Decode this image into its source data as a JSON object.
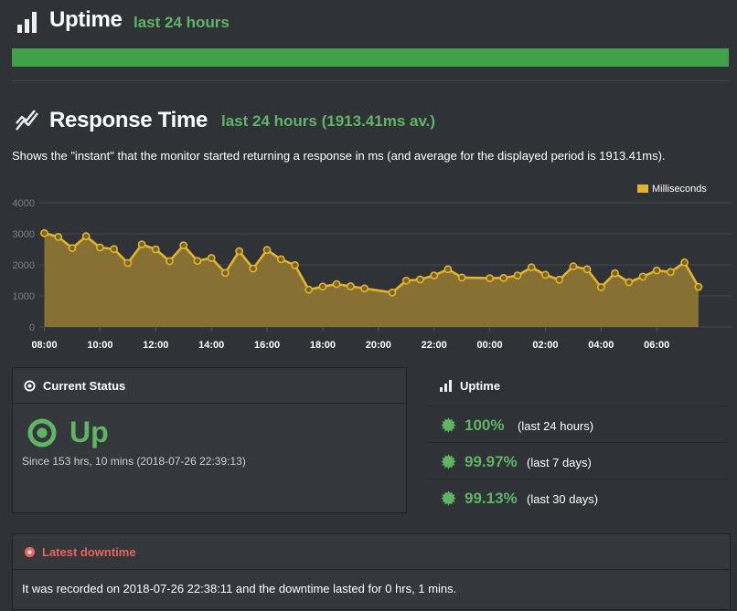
{
  "uptime_header": {
    "title": "Uptime",
    "subtitle": "last 24 hours",
    "bar_fraction": 1.0,
    "bar_color": "#3fa148"
  },
  "response_time": {
    "title": "Response Time",
    "subtitle": "last 24 hours (1913.41ms av.)",
    "description": "Shows the \"instant\" that the monitor started returning a response in ms (and average for the displayed period is 1913.41ms)."
  },
  "chart_data": {
    "type": "area",
    "legend": [
      {
        "label": "Milliseconds",
        "color": "#e2b42c"
      }
    ],
    "legend_position": "top-right",
    "grid": true,
    "y_ticks": [
      "0",
      "1000",
      "2000",
      "3000",
      "4000"
    ],
    "ylim": [
      0,
      4000
    ],
    "x_ticks": [
      "08:00",
      "10:00",
      "12:00",
      "14:00",
      "16:00",
      "18:00",
      "20:00",
      "22:00",
      "00:00",
      "02:00",
      "04:00",
      "06:00"
    ],
    "x_hours": [
      0,
      2,
      4,
      6,
      8,
      10,
      12,
      14,
      16,
      18,
      20,
      22
    ],
    "x_range_hours": [
      -0.05,
      23.8
    ],
    "series": [
      {
        "name": "Milliseconds",
        "x_hours": [
          0,
          0.5,
          1,
          1.5,
          2,
          2.5,
          3,
          3.5,
          4,
          4.5,
          5,
          5.5,
          6,
          6.5,
          7,
          7.5,
          8,
          8.5,
          9,
          9.5,
          10,
          10.5,
          11,
          11.5,
          12.5,
          13,
          13.5,
          14,
          14.5,
          15,
          16,
          16.5,
          17,
          17.5,
          18,
          18.5,
          19,
          19.5,
          20,
          20.5,
          21,
          21.5,
          22,
          22.5,
          23,
          23.5
        ],
        "values": [
          3020,
          2900,
          2540,
          2920,
          2560,
          2510,
          2060,
          2660,
          2500,
          2120,
          2630,
          2130,
          2220,
          1740,
          2440,
          1880,
          2480,
          2180,
          1990,
          1200,
          1300,
          1380,
          1310,
          1240,
          1110,
          1490,
          1530,
          1660,
          1860,
          1590,
          1570,
          1580,
          1660,
          1920,
          1680,
          1520,
          1950,
          1860,
          1280,
          1730,
          1440,
          1620,
          1820,
          1770,
          2080,
          1290
        ],
        "color": "#e2b42c"
      }
    ]
  },
  "status_panel": {
    "title": "Current Status",
    "value": "Up",
    "since": "Since 153 hrs, 10 mins (2018-07-26 22:39:13)"
  },
  "uptime_panel": {
    "title": "Uptime",
    "rows": [
      {
        "value": "100%",
        "period": "(last 24 hours)"
      },
      {
        "value": "99.97%",
        "period": "(last 7 days)"
      },
      {
        "value": "99.13%",
        "period": "(last 30 days)"
      }
    ]
  },
  "downtime_panel": {
    "title": "Latest downtime",
    "text": "It was recorded on 2018-07-26 22:38:11 and the downtime lasted for 0 hrs, 1 mins."
  },
  "colors": {
    "up_green": "#5fb564",
    "down_red": "#e9625b",
    "series_yellow": "#e2b42c"
  },
  "icons": [
    "bar-chart-icon",
    "line-chart-icon",
    "circle-dot-icon",
    "burst-icon"
  ]
}
